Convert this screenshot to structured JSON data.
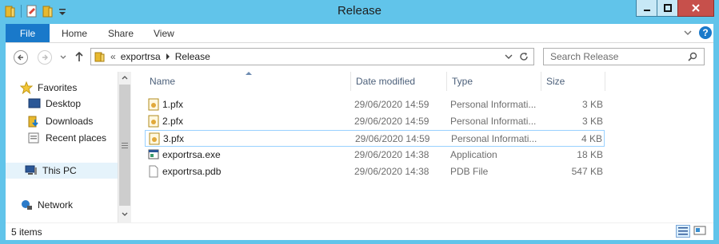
{
  "window": {
    "title": "Release"
  },
  "ribbon": {
    "tabs": [
      "File",
      "Home",
      "Share",
      "View"
    ]
  },
  "address": {
    "path": [
      "exportrsa",
      "Release"
    ],
    "overflow": "«"
  },
  "search": {
    "placeholder": "Search Release"
  },
  "nav": {
    "favorites": "Favorites",
    "items": [
      "Desktop",
      "Downloads",
      "Recent places"
    ],
    "this_pc": "This PC",
    "network": "Network"
  },
  "list": {
    "columns": [
      "Name",
      "Date modified",
      "Type",
      "Size"
    ],
    "sorted_column": "Name",
    "rows": [
      {
        "name": "1.pfx",
        "date": "29/06/2020 14:59",
        "type": "Personal Informati...",
        "size": "3 KB",
        "icon": "certificate-icon"
      },
      {
        "name": "2.pfx",
        "date": "29/06/2020 14:59",
        "type": "Personal Informati...",
        "size": "3 KB",
        "icon": "certificate-icon"
      },
      {
        "name": "3.pfx",
        "date": "29/06/2020 14:59",
        "type": "Personal Informati...",
        "size": "4 KB",
        "icon": "certificate-icon"
      },
      {
        "name": "exportrsa.exe",
        "date": "29/06/2020 14:38",
        "type": "Application",
        "size": "18 KB",
        "icon": "application-icon"
      },
      {
        "name": "exportrsa.pdb",
        "date": "29/06/2020 14:38",
        "type": "PDB File",
        "size": "547 KB",
        "icon": "file-icon"
      }
    ],
    "selected_row": "3.pfx"
  },
  "status": {
    "count": "5 items"
  },
  "colors": {
    "frame": "#61c4ea",
    "file_tab": "#1979ca",
    "close": "#c7504b",
    "selection_border": "#99d1ff",
    "header_text": "#4c607a"
  }
}
